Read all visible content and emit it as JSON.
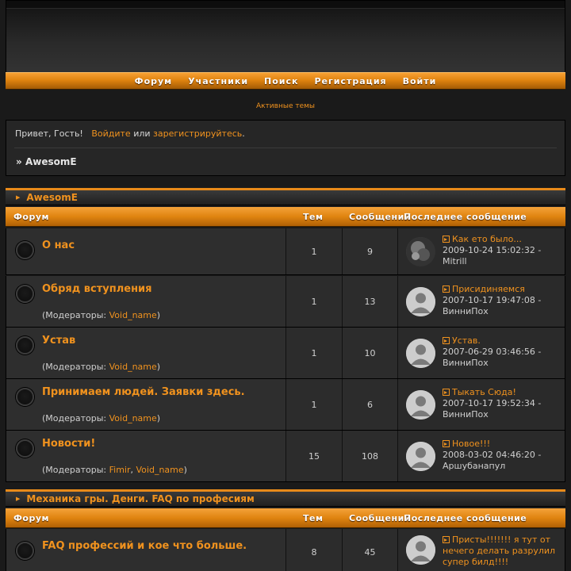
{
  "nav": {
    "items": [
      "Форум",
      "Участники",
      "Поиск",
      "Регистрация",
      "Войти"
    ]
  },
  "active_topics": "Активные темы",
  "welcome": {
    "greeting": "Привет, Гость!",
    "login": "Войдите",
    "or": "или",
    "register": "зарегистрируйтесь",
    "period": "."
  },
  "breadcrumb": {
    "prefix": "»",
    "label": "AwesomE"
  },
  "columns": {
    "forum": "Форум",
    "topics": "Тем",
    "posts": "Сообщений",
    "last": "Последнее сообщение"
  },
  "mods_prefix": "(Модераторы: ",
  "mods_suffix": ")",
  "mods_sep": ", ",
  "last_by": " - ",
  "categories": [
    {
      "title": "AwesomE",
      "forums": [
        {
          "title": "О нас",
          "mods": [],
          "topics": "1",
          "posts": "9",
          "last": {
            "topic": "Как ето было...",
            "date": "2009-10-24 15:02:32",
            "author": "Mitrill",
            "avatar": "photo"
          }
        },
        {
          "title": "Обряд вступления",
          "mods": [
            "Void_name"
          ],
          "topics": "1",
          "posts": "13",
          "last": {
            "topic": "Присидиняемся",
            "date": "2007-10-17 19:47:08",
            "author": "ВинниПох",
            "avatar": "default"
          }
        },
        {
          "title": "Устав",
          "mods": [
            "Void_name"
          ],
          "topics": "1",
          "posts": "10",
          "last": {
            "topic": "Устав.",
            "date": "2007-06-29 03:46:56",
            "author": "ВинниПох",
            "avatar": "default"
          }
        },
        {
          "title": "Принимаем людей. Заявки здесь.",
          "mods": [
            "Void_name"
          ],
          "topics": "1",
          "posts": "6",
          "last": {
            "topic": "Тыкать Сюда!",
            "date": "2007-10-17 19:52:34",
            "author": "ВинниПох",
            "avatar": "default"
          }
        },
        {
          "title": "Новости!",
          "mods": [
            "Fimir",
            "Void_name"
          ],
          "topics": "15",
          "posts": "108",
          "last": {
            "topic": "Новое!!!",
            "date": "2008-03-02 04:46:20",
            "author": "Аршубанапул",
            "avatar": "default"
          }
        }
      ]
    },
    {
      "title": "Механика гры. Денги. FAQ по професиям",
      "forums": [
        {
          "title": "FAQ профессий и кое что больше.",
          "mods": [],
          "topics": "8",
          "posts": "45",
          "last": {
            "topic": "Присты!!!!!!! я тут от нечего делать разрулил супер билд!!!!",
            "date": "",
            "author": "",
            "avatar": "default"
          }
        }
      ]
    }
  ]
}
